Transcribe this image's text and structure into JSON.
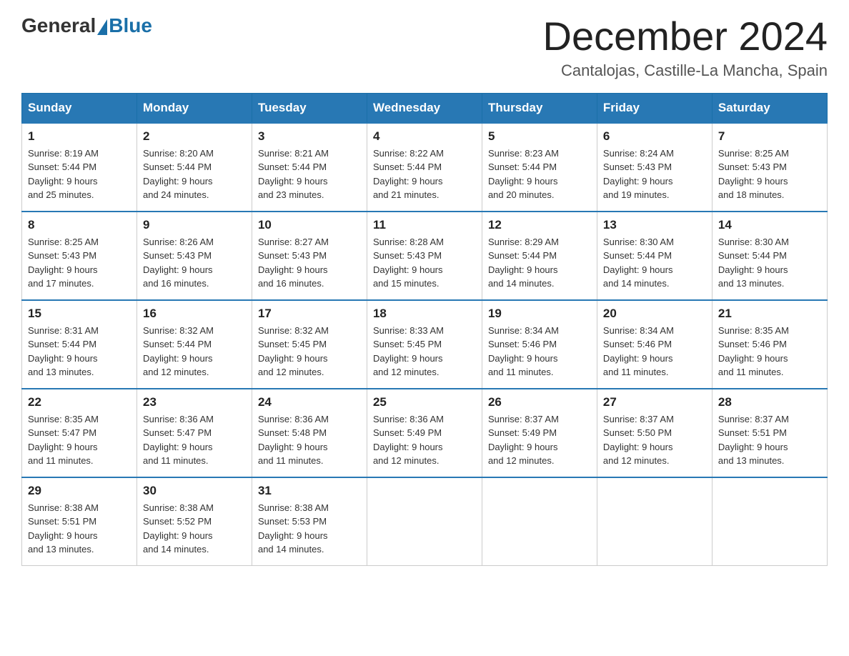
{
  "logo": {
    "general": "General",
    "blue": "Blue"
  },
  "title": {
    "month_year": "December 2024",
    "location": "Cantalojas, Castille-La Mancha, Spain"
  },
  "weekdays": [
    "Sunday",
    "Monday",
    "Tuesday",
    "Wednesday",
    "Thursday",
    "Friday",
    "Saturday"
  ],
  "weeks": [
    [
      {
        "day": "1",
        "sunrise": "8:19 AM",
        "sunset": "5:44 PM",
        "daylight": "9 hours and 25 minutes."
      },
      {
        "day": "2",
        "sunrise": "8:20 AM",
        "sunset": "5:44 PM",
        "daylight": "9 hours and 24 minutes."
      },
      {
        "day": "3",
        "sunrise": "8:21 AM",
        "sunset": "5:44 PM",
        "daylight": "9 hours and 23 minutes."
      },
      {
        "day": "4",
        "sunrise": "8:22 AM",
        "sunset": "5:44 PM",
        "daylight": "9 hours and 21 minutes."
      },
      {
        "day": "5",
        "sunrise": "8:23 AM",
        "sunset": "5:44 PM",
        "daylight": "9 hours and 20 minutes."
      },
      {
        "day": "6",
        "sunrise": "8:24 AM",
        "sunset": "5:43 PM",
        "daylight": "9 hours and 19 minutes."
      },
      {
        "day": "7",
        "sunrise": "8:25 AM",
        "sunset": "5:43 PM",
        "daylight": "9 hours and 18 minutes."
      }
    ],
    [
      {
        "day": "8",
        "sunrise": "8:25 AM",
        "sunset": "5:43 PM",
        "daylight": "9 hours and 17 minutes."
      },
      {
        "day": "9",
        "sunrise": "8:26 AM",
        "sunset": "5:43 PM",
        "daylight": "9 hours and 16 minutes."
      },
      {
        "day": "10",
        "sunrise": "8:27 AM",
        "sunset": "5:43 PM",
        "daylight": "9 hours and 16 minutes."
      },
      {
        "day": "11",
        "sunrise": "8:28 AM",
        "sunset": "5:43 PM",
        "daylight": "9 hours and 15 minutes."
      },
      {
        "day": "12",
        "sunrise": "8:29 AM",
        "sunset": "5:44 PM",
        "daylight": "9 hours and 14 minutes."
      },
      {
        "day": "13",
        "sunrise": "8:30 AM",
        "sunset": "5:44 PM",
        "daylight": "9 hours and 14 minutes."
      },
      {
        "day": "14",
        "sunrise": "8:30 AM",
        "sunset": "5:44 PM",
        "daylight": "9 hours and 13 minutes."
      }
    ],
    [
      {
        "day": "15",
        "sunrise": "8:31 AM",
        "sunset": "5:44 PM",
        "daylight": "9 hours and 13 minutes."
      },
      {
        "day": "16",
        "sunrise": "8:32 AM",
        "sunset": "5:44 PM",
        "daylight": "9 hours and 12 minutes."
      },
      {
        "day": "17",
        "sunrise": "8:32 AM",
        "sunset": "5:45 PM",
        "daylight": "9 hours and 12 minutes."
      },
      {
        "day": "18",
        "sunrise": "8:33 AM",
        "sunset": "5:45 PM",
        "daylight": "9 hours and 12 minutes."
      },
      {
        "day": "19",
        "sunrise": "8:34 AM",
        "sunset": "5:46 PM",
        "daylight": "9 hours and 11 minutes."
      },
      {
        "day": "20",
        "sunrise": "8:34 AM",
        "sunset": "5:46 PM",
        "daylight": "9 hours and 11 minutes."
      },
      {
        "day": "21",
        "sunrise": "8:35 AM",
        "sunset": "5:46 PM",
        "daylight": "9 hours and 11 minutes."
      }
    ],
    [
      {
        "day": "22",
        "sunrise": "8:35 AM",
        "sunset": "5:47 PM",
        "daylight": "9 hours and 11 minutes."
      },
      {
        "day": "23",
        "sunrise": "8:36 AM",
        "sunset": "5:47 PM",
        "daylight": "9 hours and 11 minutes."
      },
      {
        "day": "24",
        "sunrise": "8:36 AM",
        "sunset": "5:48 PM",
        "daylight": "9 hours and 11 minutes."
      },
      {
        "day": "25",
        "sunrise": "8:36 AM",
        "sunset": "5:49 PM",
        "daylight": "9 hours and 12 minutes."
      },
      {
        "day": "26",
        "sunrise": "8:37 AM",
        "sunset": "5:49 PM",
        "daylight": "9 hours and 12 minutes."
      },
      {
        "day": "27",
        "sunrise": "8:37 AM",
        "sunset": "5:50 PM",
        "daylight": "9 hours and 12 minutes."
      },
      {
        "day": "28",
        "sunrise": "8:37 AM",
        "sunset": "5:51 PM",
        "daylight": "9 hours and 13 minutes."
      }
    ],
    [
      {
        "day": "29",
        "sunrise": "8:38 AM",
        "sunset": "5:51 PM",
        "daylight": "9 hours and 13 minutes."
      },
      {
        "day": "30",
        "sunrise": "8:38 AM",
        "sunset": "5:52 PM",
        "daylight": "9 hours and 14 minutes."
      },
      {
        "day": "31",
        "sunrise": "8:38 AM",
        "sunset": "5:53 PM",
        "daylight": "9 hours and 14 minutes."
      },
      null,
      null,
      null,
      null
    ]
  ],
  "cell_labels": {
    "sunrise": "Sunrise:",
    "sunset": "Sunset:",
    "daylight": "Daylight:"
  }
}
